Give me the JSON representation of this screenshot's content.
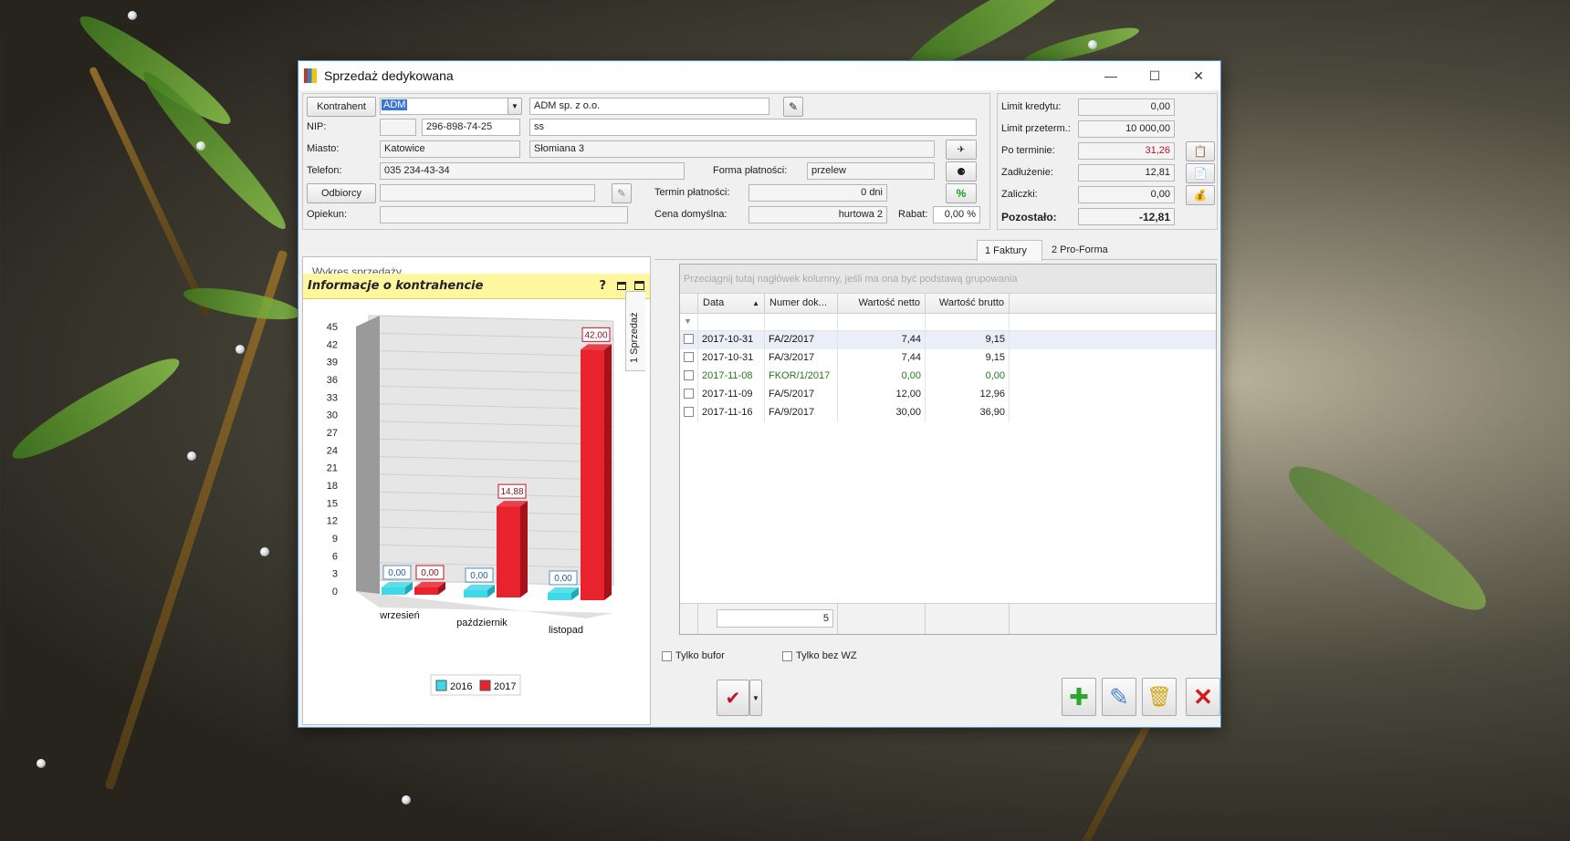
{
  "window": {
    "title": "Sprzedaż dedykowana"
  },
  "titlebar": {
    "minimize": "—",
    "maximize": "☐",
    "close": "✕"
  },
  "form": {
    "kontrahent_btn": "Kontrahent",
    "kontrahent_code": "ADM",
    "kontrahent_name": "ADM sp. z o.o.",
    "nip_label": "NIP:",
    "nip": "296-898-74-25",
    "nip_extra": "ss",
    "miasto_label": "Miasto:",
    "miasto": "Katowice",
    "ulica": "Słomiana 3",
    "telefon_label": "Telefon:",
    "telefon": "035 234-43-34",
    "forma_label": "Forma  płatności:",
    "forma": "przelew",
    "odbiorcy_btn": "Odbiorcy",
    "termin_label": "Termin płatności:",
    "termin": "0 dni",
    "opiekun_label": "Opiekun:",
    "cena_label": "Cena domyślna:",
    "cena": "hurtowa 2",
    "rabat_label": "Rabat:",
    "rabat": "0,00 %"
  },
  "finance": {
    "limit_kredytu_label": "Limit kredytu:",
    "limit_kredytu": "0,00",
    "limit_przeterm_label": "Limit przeterm.:",
    "limit_przeterm": "10 000,00",
    "po_terminie_label": "Po terminie:",
    "po_terminie": "31,26",
    "zadluzenie_label": "Zadłużenie:",
    "zadluzenie": "12,81",
    "zaliczki_label": "Zaliczki:",
    "zaliczki": "0,00",
    "pozostalo_label": "Pozostało:",
    "pozostalo": "-12,81"
  },
  "left_panel": {
    "collapsed_title": "Wykres sprzedaży",
    "info_title": "Informacje o kontrahencie",
    "help": "?",
    "vtab": "1 Sprzedaż"
  },
  "chart_data": {
    "type": "bar",
    "categories": [
      "wrzesień",
      "październik",
      "listopad"
    ],
    "series": [
      {
        "name": "2016",
        "values": [
          0.0,
          0.0,
          0.0
        ],
        "labels": [
          "0,00",
          "0,00",
          "0,00"
        ],
        "color": "#3fd8e8"
      },
      {
        "name": "2017",
        "values": [
          0.0,
          14.88,
          42.0
        ],
        "labels": [
          "0,00",
          "14,88",
          "42,00"
        ],
        "color": "#e8232e"
      }
    ],
    "yticks": [
      0,
      3,
      6,
      9,
      12,
      15,
      18,
      21,
      24,
      27,
      30,
      33,
      36,
      39,
      42,
      45
    ],
    "ylim": [
      0,
      45
    ],
    "legend": "bottom"
  },
  "tabs": [
    {
      "label": "1 Faktury"
    },
    {
      "label": "2 Pro-Forma"
    }
  ],
  "grid": {
    "group_hint": "Przeciągnij tutaj nagłówek kolumny, jeśli ma ona być podstawą grupowania",
    "columns": [
      "Data",
      "Numer dok...",
      "Wartość netto",
      "Wartość brutto"
    ],
    "rows": [
      {
        "data": "2017-10-31",
        "numer": "FA/2/2017",
        "netto": "7,44",
        "brutto": "9,15"
      },
      {
        "data": "2017-10-31",
        "numer": "FA/3/2017",
        "netto": "7,44",
        "brutto": "9,15"
      },
      {
        "data": "2017-11-08",
        "numer": "FKOR/1/2017",
        "netto": "0,00",
        "brutto": "0,00"
      },
      {
        "data": "2017-11-09",
        "numer": "FA/5/2017",
        "netto": "12,00",
        "brutto": "12,96"
      },
      {
        "data": "2017-11-16",
        "numer": "FA/9/2017",
        "netto": "30,00",
        "brutto": "36,90"
      }
    ],
    "count": "5"
  },
  "options": {
    "tylko_bufor": "Tylko bufor",
    "tylko_bez_wz": "Tylko bez WZ"
  },
  "actions": {
    "add": "✚",
    "close": "✕"
  }
}
